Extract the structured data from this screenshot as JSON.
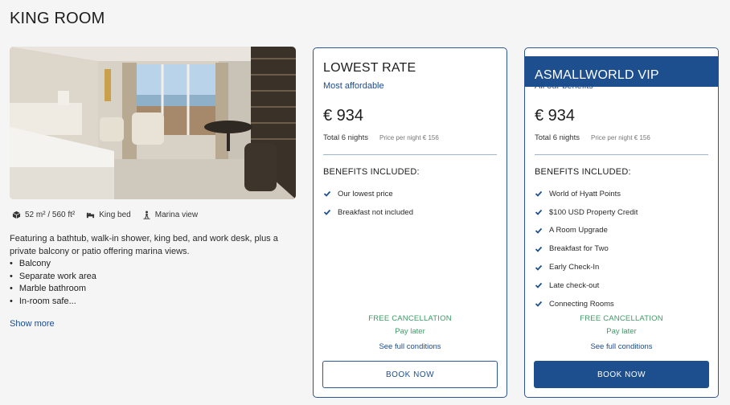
{
  "room": {
    "title": "KING ROOM",
    "size": "52 m² / 560 ft²",
    "bed": "King bed",
    "view": "Marina view",
    "description": "Featuring a bathtub, walk-in shower, king bed, and work desk, plus a private balcony or patio offering marina views.",
    "features": [
      "Balcony",
      "Separate work area",
      "Marble bathroom",
      "In-room safe..."
    ],
    "show_more": "Show more"
  },
  "icons": {
    "size": "cube-icon",
    "bed": "bed-icon",
    "view": "person-view-icon",
    "check": "check-icon"
  },
  "colors": {
    "brand_blue": "#1d4f8f",
    "link_blue": "#1c4b8c",
    "green": "#3f9a67"
  },
  "rates": [
    {
      "title": "LOWEST RATE",
      "subtitle": "Most affordable",
      "price": "€ 934",
      "total": "Total 6 nights",
      "per_night": "Price per night € 156",
      "benefits_heading": "BENEFITS INCLUDED:",
      "benefits": [
        "Our lowest price",
        "Breakfast not included"
      ],
      "free_cancellation": "FREE CANCELLATION",
      "pay_later": "Pay later",
      "conditions": "See full conditions",
      "book": "BOOK NOW"
    },
    {
      "title": "ASMALLWORLD VIP",
      "subtitle": "All our benefits",
      "price": "€ 934",
      "total": "Total 6 nights",
      "per_night": "Price per night € 156",
      "benefits_heading": "BENEFITS INCLUDED:",
      "benefits": [
        "World of Hyatt Points",
        "$100 USD Property Credit",
        "A Room Upgrade",
        "Breakfast for Two",
        "Early Check-In",
        "Late check-out",
        "Connecting Rooms"
      ],
      "free_cancellation": "FREE CANCELLATION",
      "pay_later": "Pay later",
      "conditions": "See full conditions",
      "book": "BOOK NOW"
    }
  ]
}
